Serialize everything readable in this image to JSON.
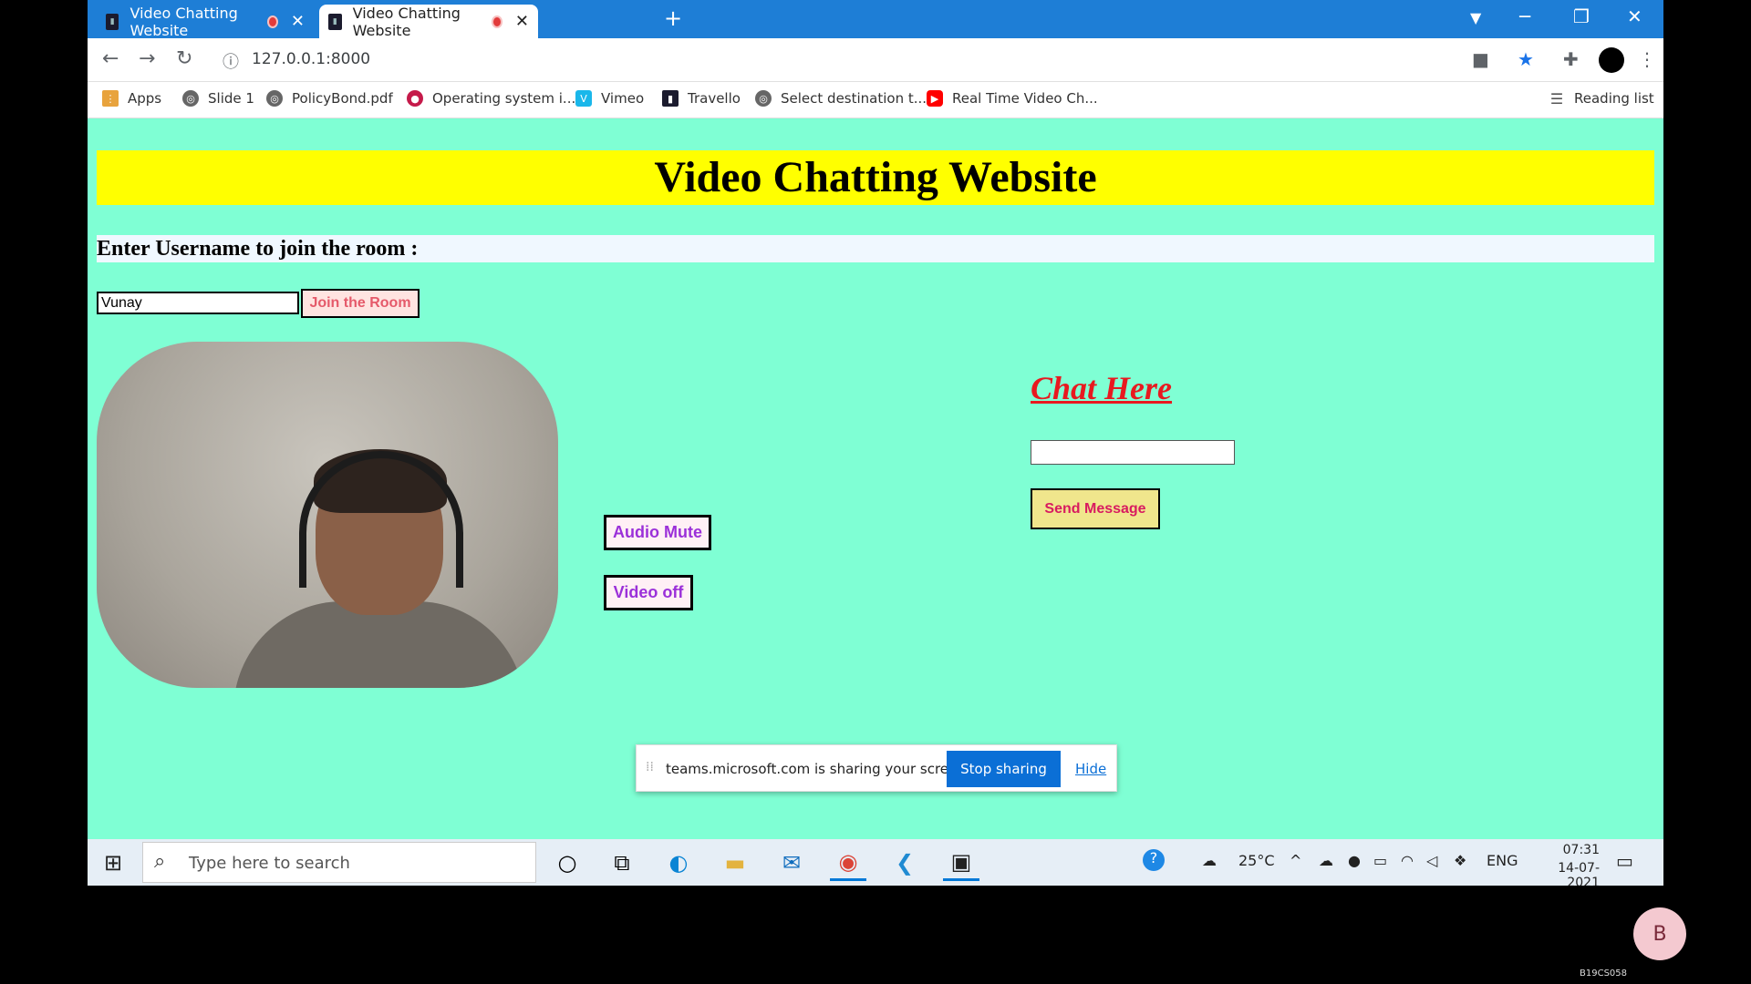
{
  "browser": {
    "tabs": [
      {
        "title": "Video Chatting Website",
        "active": false
      },
      {
        "title": "Video Chatting Website",
        "active": true
      }
    ],
    "new_tab_icon": "plus-icon",
    "url": "127.0.0.1:8000",
    "bookmarks": [
      "Apps",
      "Slide 1",
      "PolicyBond.pdf",
      "Operating system i...",
      "Vimeo",
      "Travello",
      "Select destination t...",
      "Real Time Video Ch..."
    ],
    "reading_list": "Reading list",
    "accent_color": "#1e7ed6"
  },
  "page": {
    "title": "Video Chatting Website",
    "username_label": "Enter Username to join the room :",
    "username_value": "Vunay",
    "join_button": "Join the Room",
    "audio_button": "Audio Mute",
    "video_button": "Video off",
    "chat_title": "Chat Here",
    "chat_input_value": "",
    "send_button": "Send Message",
    "background_color": "#7fffd4",
    "header_color": "#ffff00"
  },
  "share_bar": {
    "text": "teams.microsoft.com is sharing your screen.",
    "stop_button": "Stop sharing",
    "hide_link": "Hide"
  },
  "taskbar": {
    "search_placeholder": "Type here to search",
    "weather": "25°C",
    "language": "ENG",
    "time": "07:31",
    "date": "14-07-2021"
  },
  "meeting": {
    "participant_initial": "B",
    "participant_name": "B19CS058"
  }
}
